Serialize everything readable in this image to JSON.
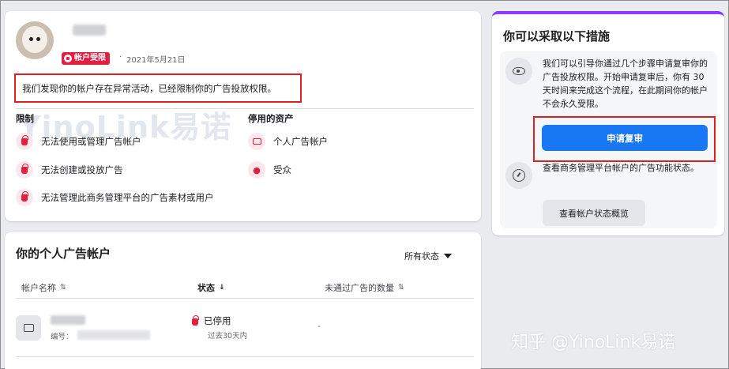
{
  "status_card": {
    "badge": "帐户受限",
    "date": "2021年5月21日",
    "alert": "我们发现你的帐户存在异常活动，已经限制你的广告投放权限。",
    "watermark": "YinoLink易诺",
    "restrictions": {
      "heading": "限制",
      "items": [
        {
          "label": "无法使用或管理广告帐户",
          "icon": "lock-icon"
        },
        {
          "label": "无法创建或投放广告",
          "icon": "lock-icon"
        },
        {
          "label": "无法管理此商务管理平台的广告素材或用户",
          "icon": "lock-icon"
        }
      ]
    },
    "disabled_assets": {
      "heading": "停用的资产",
      "items": [
        {
          "label": "个人广告帐户",
          "icon": "ad-account-icon"
        },
        {
          "label": "受众",
          "icon": "audience-icon"
        }
      ]
    }
  },
  "accounts_card": {
    "title": "你的个人广告帐户",
    "filter": "所有状态",
    "columns": [
      {
        "label": "帐户名称",
        "sort": "⇅"
      },
      {
        "label": "状态",
        "sort": "↓"
      },
      {
        "label": "未通过广告的数量",
        "sort": "⇅"
      }
    ],
    "rows": [
      {
        "id_label": "编号：",
        "status": "已停用",
        "status_sub": "过去30天内",
        "rejected_count": "-"
      }
    ]
  },
  "actions_card": {
    "title": "你可以采取以下措施",
    "appeal_text": "我们可以引导你通过几个步骤申请复审你的广告投放权限。开始申请复审后，你有 30 天时间来完成这个流程，在此期间你的帐户不会永久受限。",
    "appeal_button": "申请复审",
    "quality_text": "查看商务管理平台帐户的广告功能状态。",
    "overview_button": "查看帐户状态概览"
  },
  "overlay_watermark": "知乎 @YinoLink易诺",
  "colors": {
    "brand_blue": "#1877f2",
    "restriction_red": "#e41e3f",
    "highlight_red": "#e02020",
    "purple_accent": "#8b3cff"
  }
}
